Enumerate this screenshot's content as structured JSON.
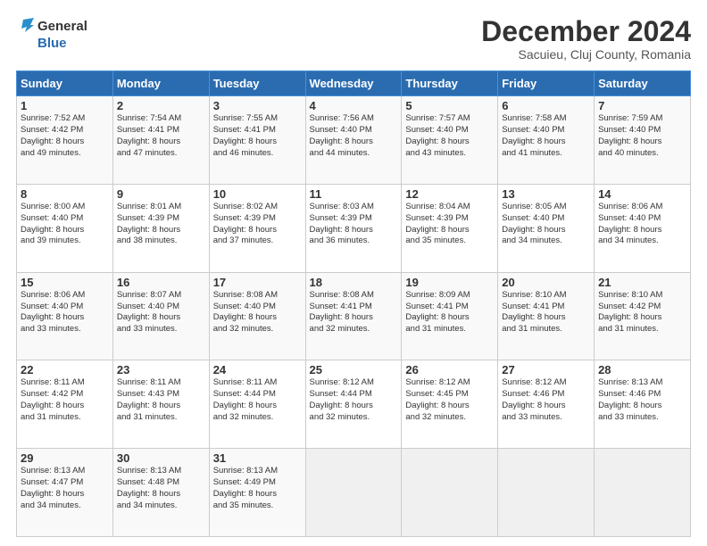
{
  "header": {
    "logo_line1": "General",
    "logo_line2": "Blue",
    "main_title": "December 2024",
    "subtitle": "Sacuieu, Cluj County, Romania"
  },
  "weekdays": [
    "Sunday",
    "Monday",
    "Tuesday",
    "Wednesday",
    "Thursday",
    "Friday",
    "Saturday"
  ],
  "weeks": [
    [
      {
        "day": "1",
        "lines": [
          "Sunrise: 7:52 AM",
          "Sunset: 4:42 PM",
          "Daylight: 8 hours",
          "and 49 minutes."
        ]
      },
      {
        "day": "2",
        "lines": [
          "Sunrise: 7:54 AM",
          "Sunset: 4:41 PM",
          "Daylight: 8 hours",
          "and 47 minutes."
        ]
      },
      {
        "day": "3",
        "lines": [
          "Sunrise: 7:55 AM",
          "Sunset: 4:41 PM",
          "Daylight: 8 hours",
          "and 46 minutes."
        ]
      },
      {
        "day": "4",
        "lines": [
          "Sunrise: 7:56 AM",
          "Sunset: 4:40 PM",
          "Daylight: 8 hours",
          "and 44 minutes."
        ]
      },
      {
        "day": "5",
        "lines": [
          "Sunrise: 7:57 AM",
          "Sunset: 4:40 PM",
          "Daylight: 8 hours",
          "and 43 minutes."
        ]
      },
      {
        "day": "6",
        "lines": [
          "Sunrise: 7:58 AM",
          "Sunset: 4:40 PM",
          "Daylight: 8 hours",
          "and 41 minutes."
        ]
      },
      {
        "day": "7",
        "lines": [
          "Sunrise: 7:59 AM",
          "Sunset: 4:40 PM",
          "Daylight: 8 hours",
          "and 40 minutes."
        ]
      }
    ],
    [
      {
        "day": "8",
        "lines": [
          "Sunrise: 8:00 AM",
          "Sunset: 4:40 PM",
          "Daylight: 8 hours",
          "and 39 minutes."
        ]
      },
      {
        "day": "9",
        "lines": [
          "Sunrise: 8:01 AM",
          "Sunset: 4:39 PM",
          "Daylight: 8 hours",
          "and 38 minutes."
        ]
      },
      {
        "day": "10",
        "lines": [
          "Sunrise: 8:02 AM",
          "Sunset: 4:39 PM",
          "Daylight: 8 hours",
          "and 37 minutes."
        ]
      },
      {
        "day": "11",
        "lines": [
          "Sunrise: 8:03 AM",
          "Sunset: 4:39 PM",
          "Daylight: 8 hours",
          "and 36 minutes."
        ]
      },
      {
        "day": "12",
        "lines": [
          "Sunrise: 8:04 AM",
          "Sunset: 4:39 PM",
          "Daylight: 8 hours",
          "and 35 minutes."
        ]
      },
      {
        "day": "13",
        "lines": [
          "Sunrise: 8:05 AM",
          "Sunset: 4:40 PM",
          "Daylight: 8 hours",
          "and 34 minutes."
        ]
      },
      {
        "day": "14",
        "lines": [
          "Sunrise: 8:06 AM",
          "Sunset: 4:40 PM",
          "Daylight: 8 hours",
          "and 34 minutes."
        ]
      }
    ],
    [
      {
        "day": "15",
        "lines": [
          "Sunrise: 8:06 AM",
          "Sunset: 4:40 PM",
          "Daylight: 8 hours",
          "and 33 minutes."
        ]
      },
      {
        "day": "16",
        "lines": [
          "Sunrise: 8:07 AM",
          "Sunset: 4:40 PM",
          "Daylight: 8 hours",
          "and 33 minutes."
        ]
      },
      {
        "day": "17",
        "lines": [
          "Sunrise: 8:08 AM",
          "Sunset: 4:40 PM",
          "Daylight: 8 hours",
          "and 32 minutes."
        ]
      },
      {
        "day": "18",
        "lines": [
          "Sunrise: 8:08 AM",
          "Sunset: 4:41 PM",
          "Daylight: 8 hours",
          "and 32 minutes."
        ]
      },
      {
        "day": "19",
        "lines": [
          "Sunrise: 8:09 AM",
          "Sunset: 4:41 PM",
          "Daylight: 8 hours",
          "and 31 minutes."
        ]
      },
      {
        "day": "20",
        "lines": [
          "Sunrise: 8:10 AM",
          "Sunset: 4:41 PM",
          "Daylight: 8 hours",
          "and 31 minutes."
        ]
      },
      {
        "day": "21",
        "lines": [
          "Sunrise: 8:10 AM",
          "Sunset: 4:42 PM",
          "Daylight: 8 hours",
          "and 31 minutes."
        ]
      }
    ],
    [
      {
        "day": "22",
        "lines": [
          "Sunrise: 8:11 AM",
          "Sunset: 4:42 PM",
          "Daylight: 8 hours",
          "and 31 minutes."
        ]
      },
      {
        "day": "23",
        "lines": [
          "Sunrise: 8:11 AM",
          "Sunset: 4:43 PM",
          "Daylight: 8 hours",
          "and 31 minutes."
        ]
      },
      {
        "day": "24",
        "lines": [
          "Sunrise: 8:11 AM",
          "Sunset: 4:44 PM",
          "Daylight: 8 hours",
          "and 32 minutes."
        ]
      },
      {
        "day": "25",
        "lines": [
          "Sunrise: 8:12 AM",
          "Sunset: 4:44 PM",
          "Daylight: 8 hours",
          "and 32 minutes."
        ]
      },
      {
        "day": "26",
        "lines": [
          "Sunrise: 8:12 AM",
          "Sunset: 4:45 PM",
          "Daylight: 8 hours",
          "and 32 minutes."
        ]
      },
      {
        "day": "27",
        "lines": [
          "Sunrise: 8:12 AM",
          "Sunset: 4:46 PM",
          "Daylight: 8 hours",
          "and 33 minutes."
        ]
      },
      {
        "day": "28",
        "lines": [
          "Sunrise: 8:13 AM",
          "Sunset: 4:46 PM",
          "Daylight: 8 hours",
          "and 33 minutes."
        ]
      }
    ],
    [
      {
        "day": "29",
        "lines": [
          "Sunrise: 8:13 AM",
          "Sunset: 4:47 PM",
          "Daylight: 8 hours",
          "and 34 minutes."
        ]
      },
      {
        "day": "30",
        "lines": [
          "Sunrise: 8:13 AM",
          "Sunset: 4:48 PM",
          "Daylight: 8 hours",
          "and 34 minutes."
        ]
      },
      {
        "day": "31",
        "lines": [
          "Sunrise: 8:13 AM",
          "Sunset: 4:49 PM",
          "Daylight: 8 hours",
          "and 35 minutes."
        ]
      },
      {
        "day": "",
        "lines": []
      },
      {
        "day": "",
        "lines": []
      },
      {
        "day": "",
        "lines": []
      },
      {
        "day": "",
        "lines": []
      }
    ]
  ]
}
